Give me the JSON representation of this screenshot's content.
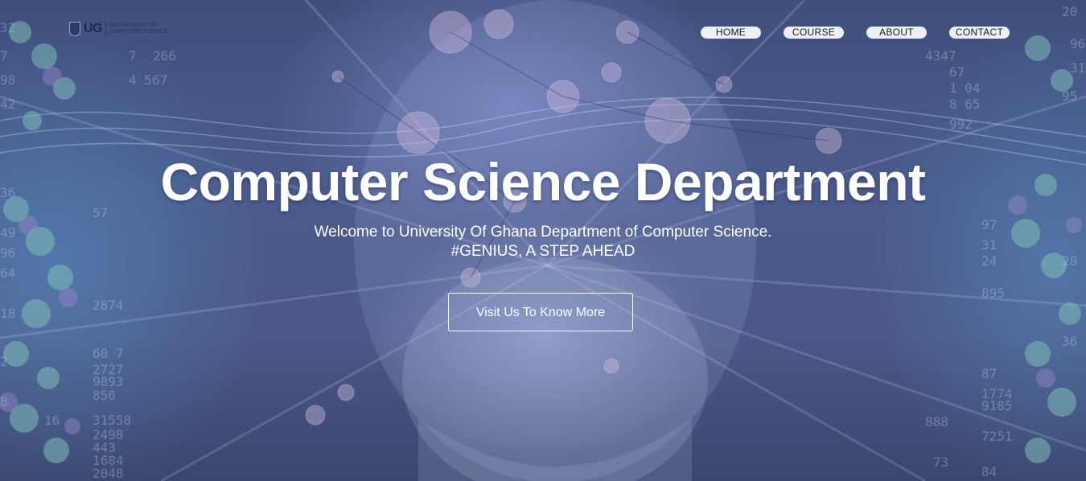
{
  "brand": {
    "logo_text": "UG",
    "dept_line1": "DEPARTMENT OF",
    "dept_line2": "COMPUTER SCIENCE"
  },
  "nav": {
    "items": [
      {
        "label": "HOME"
      },
      {
        "label": "COURSE"
      },
      {
        "label": "ABOUT"
      },
      {
        "label": "CONTACT"
      }
    ]
  },
  "hero": {
    "title": "Computer Science Department",
    "subtitle_line1": "Welcome to University Of Ghana Department of Computer Science.",
    "subtitle_line2": "#GENIUS, A STEP AHEAD",
    "cta_label": "Visit Us To Know More"
  }
}
